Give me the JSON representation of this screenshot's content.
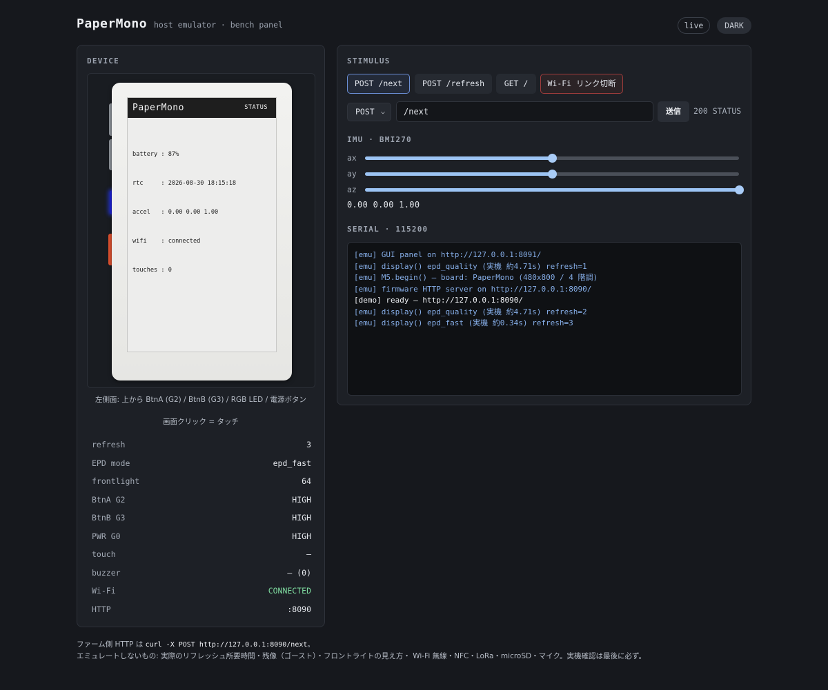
{
  "header": {
    "title": "PaperMono",
    "subtitle": "host emulator · bench panel",
    "live_label": "live",
    "theme_label": "DARK"
  },
  "device": {
    "section_label": "DEVICE",
    "screen": {
      "title": "PaperMono",
      "status": "STATUS",
      "lines": [
        "battery : 87%",
        "rtc     : 2026-08-30 18:15:18",
        "accel   : 0.00 0.00 1.00",
        "wifi    : connected",
        "touches : 0"
      ]
    },
    "caption_line1": "左側面: 上から BtnA (G2) / BtnB (G3) / RGB LED / 電源ボタン",
    "caption_line2": "画面クリック = タッチ",
    "status_rows": [
      {
        "key": "refresh",
        "value": "3"
      },
      {
        "key": "EPD mode",
        "value": "epd_fast"
      },
      {
        "key": "frontlight",
        "value": "64"
      },
      {
        "key": "BtnA G2",
        "value": "HIGH"
      },
      {
        "key": "BtnB G3",
        "value": "HIGH"
      },
      {
        "key": "PWR G0",
        "value": "HIGH"
      },
      {
        "key": "touch",
        "value": "—"
      },
      {
        "key": "buzzer",
        "value": "— (0)"
      },
      {
        "key": "Wi-Fi",
        "value": "CONNECTED"
      },
      {
        "key": "HTTP",
        "value": ":8090"
      }
    ],
    "colors": {
      "rgb_led": "#1c22d8",
      "power_button": "#e2522f",
      "wifi_ok": "#7fdca0"
    }
  },
  "stimulus": {
    "section_label": "STIMULUS",
    "quick_buttons": [
      "POST /next",
      "POST /refresh",
      "GET /",
      "Wi-Fi リンク切断"
    ],
    "method": "POST",
    "path": "/next",
    "send_label": "送信",
    "response_status": "200 STATUS"
  },
  "imu": {
    "section_label": "IMU · BMI270",
    "axes": [
      {
        "label": "ax",
        "value": 0.0
      },
      {
        "label": "ay",
        "value": 0.0
      },
      {
        "label": "az",
        "value": 1.0
      }
    ],
    "range": [
      -1,
      1
    ],
    "readout": "0.00 0.00 1.00"
  },
  "serial": {
    "section_label": "SERIAL · 115200",
    "lines": [
      {
        "kind": "emu",
        "text": "[emu] GUI panel on http://127.0.0.1:8091/"
      },
      {
        "kind": "emu",
        "text": "[emu] display() epd_quality (実機 約4.71s) refresh=1"
      },
      {
        "kind": "emu",
        "text": "[emu] M5.begin() — board: PaperMono (480x800 / 4 階調)"
      },
      {
        "kind": "emu",
        "text": "[emu] firmware HTTP server on http://127.0.0.1:8090/"
      },
      {
        "kind": "demo",
        "text": "[demo] ready — http://127.0.0.1:8090/"
      },
      {
        "kind": "emu",
        "text": "[emu] display() epd_quality (実機 約4.71s) refresh=2"
      },
      {
        "kind": "emu",
        "text": "[emu] display() epd_fast (実機 約0.34s) refresh=3"
      }
    ]
  },
  "footer": {
    "line1_prefix": "ファーム側 HTTP は ",
    "line1_code": "curl -X POST http://127.0.0.1:8090/next",
    "line1_suffix": "。",
    "line2": "エミュレートしないもの: 実際のリフレッシュ所要時間・残像（ゴースト）・フロントライトの見え方・ Wi-Fi 無線・NFC・LoRa・microSD・マイク。実機確認は最後に必ず。"
  }
}
